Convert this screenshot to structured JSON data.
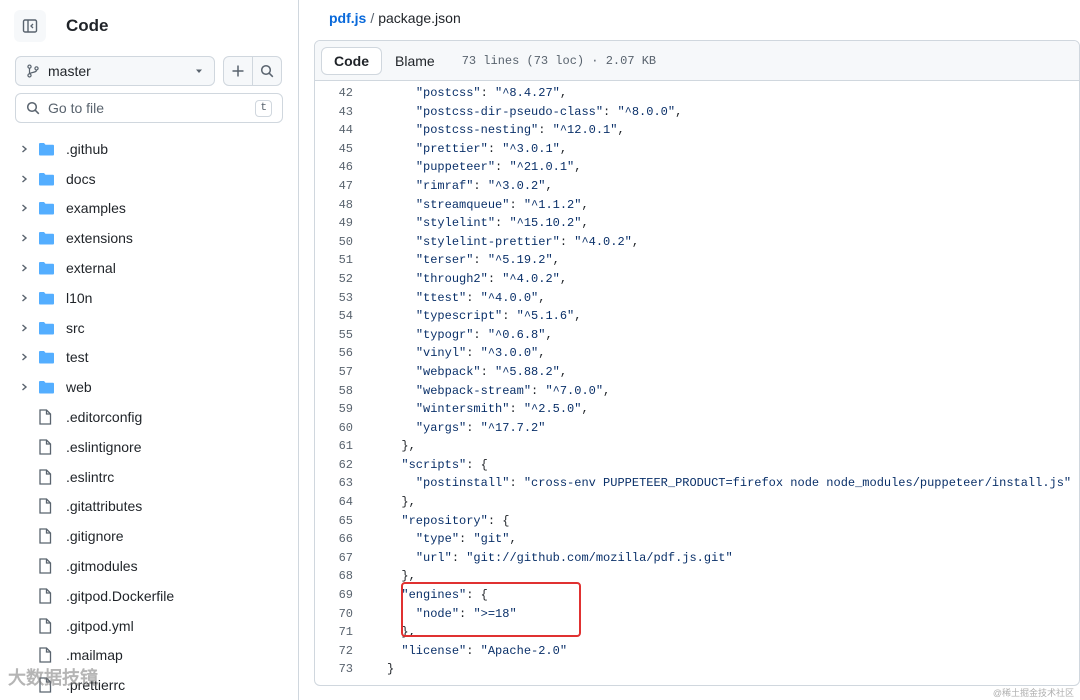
{
  "sidebar": {
    "title": "Code",
    "branch": "master",
    "goto_placeholder": "Go to file",
    "goto_shortcut": "t",
    "items": [
      {
        "name": ".github",
        "type": "folder"
      },
      {
        "name": "docs",
        "type": "folder"
      },
      {
        "name": "examples",
        "type": "folder"
      },
      {
        "name": "extensions",
        "type": "folder"
      },
      {
        "name": "external",
        "type": "folder"
      },
      {
        "name": "l10n",
        "type": "folder"
      },
      {
        "name": "src",
        "type": "folder"
      },
      {
        "name": "test",
        "type": "folder"
      },
      {
        "name": "web",
        "type": "folder"
      },
      {
        "name": ".editorconfig",
        "type": "file"
      },
      {
        "name": ".eslintignore",
        "type": "file"
      },
      {
        "name": ".eslintrc",
        "type": "file"
      },
      {
        "name": ".gitattributes",
        "type": "file"
      },
      {
        "name": ".gitignore",
        "type": "file"
      },
      {
        "name": ".gitmodules",
        "type": "file"
      },
      {
        "name": ".gitpod.Dockerfile",
        "type": "file"
      },
      {
        "name": ".gitpod.yml",
        "type": "file"
      },
      {
        "name": ".mailmap",
        "type": "file"
      },
      {
        "name": ".prettierrc",
        "type": "file"
      }
    ]
  },
  "breadcrumb": {
    "repo": "pdf.js",
    "separator": "/",
    "file": "package.json"
  },
  "code_header": {
    "code_tab": "Code",
    "blame_tab": "Blame",
    "meta": "73 lines (73 loc) · 2.07 KB"
  },
  "code_lines": [
    {
      "num": "42",
      "text": "    \"postcss\": \"^8.4.27\","
    },
    {
      "num": "43",
      "text": "    \"postcss-dir-pseudo-class\": \"^8.0.0\","
    },
    {
      "num": "44",
      "text": "    \"postcss-nesting\": \"^12.0.1\","
    },
    {
      "num": "45",
      "text": "    \"prettier\": \"^3.0.1\","
    },
    {
      "num": "46",
      "text": "    \"puppeteer\": \"^21.0.1\","
    },
    {
      "num": "47",
      "text": "    \"rimraf\": \"^3.0.2\","
    },
    {
      "num": "48",
      "text": "    \"streamqueue\": \"^1.1.2\","
    },
    {
      "num": "49",
      "text": "    \"stylelint\": \"^15.10.2\","
    },
    {
      "num": "50",
      "text": "    \"stylelint-prettier\": \"^4.0.2\","
    },
    {
      "num": "51",
      "text": "    \"terser\": \"^5.19.2\","
    },
    {
      "num": "52",
      "text": "    \"through2\": \"^4.0.2\","
    },
    {
      "num": "53",
      "text": "    \"ttest\": \"^4.0.0\","
    },
    {
      "num": "54",
      "text": "    \"typescript\": \"^5.1.6\","
    },
    {
      "num": "55",
      "text": "    \"typogr\": \"^0.6.8\","
    },
    {
      "num": "56",
      "text": "    \"vinyl\": \"^3.0.0\","
    },
    {
      "num": "57",
      "text": "    \"webpack\": \"^5.88.2\","
    },
    {
      "num": "58",
      "text": "    \"webpack-stream\": \"^7.0.0\","
    },
    {
      "num": "59",
      "text": "    \"wintersmith\": \"^2.5.0\","
    },
    {
      "num": "60",
      "text": "    \"yargs\": \"^17.7.2\""
    },
    {
      "num": "61",
      "text": "  },"
    },
    {
      "num": "62",
      "text": "  \"scripts\": {"
    },
    {
      "num": "63",
      "text": "    \"postinstall\": \"cross-env PUPPETEER_PRODUCT=firefox node node_modules/puppeteer/install.js\""
    },
    {
      "num": "64",
      "text": "  },"
    },
    {
      "num": "65",
      "text": "  \"repository\": {"
    },
    {
      "num": "66",
      "text": "    \"type\": \"git\","
    },
    {
      "num": "67",
      "text": "    \"url\": \"git://github.com/mozilla/pdf.js.git\""
    },
    {
      "num": "68",
      "text": "  },"
    },
    {
      "num": "69",
      "text": "  \"engines\": {"
    },
    {
      "num": "70",
      "text": "    \"node\": \">=18\""
    },
    {
      "num": "71",
      "text": "  },"
    },
    {
      "num": "72",
      "text": "  \"license\": \"Apache-2.0\""
    },
    {
      "num": "73",
      "text": "}"
    }
  ],
  "highlight_color": "#e03131",
  "watermark_left": "大数据技镜",
  "watermark_right": "@稀土掘金技术社区"
}
